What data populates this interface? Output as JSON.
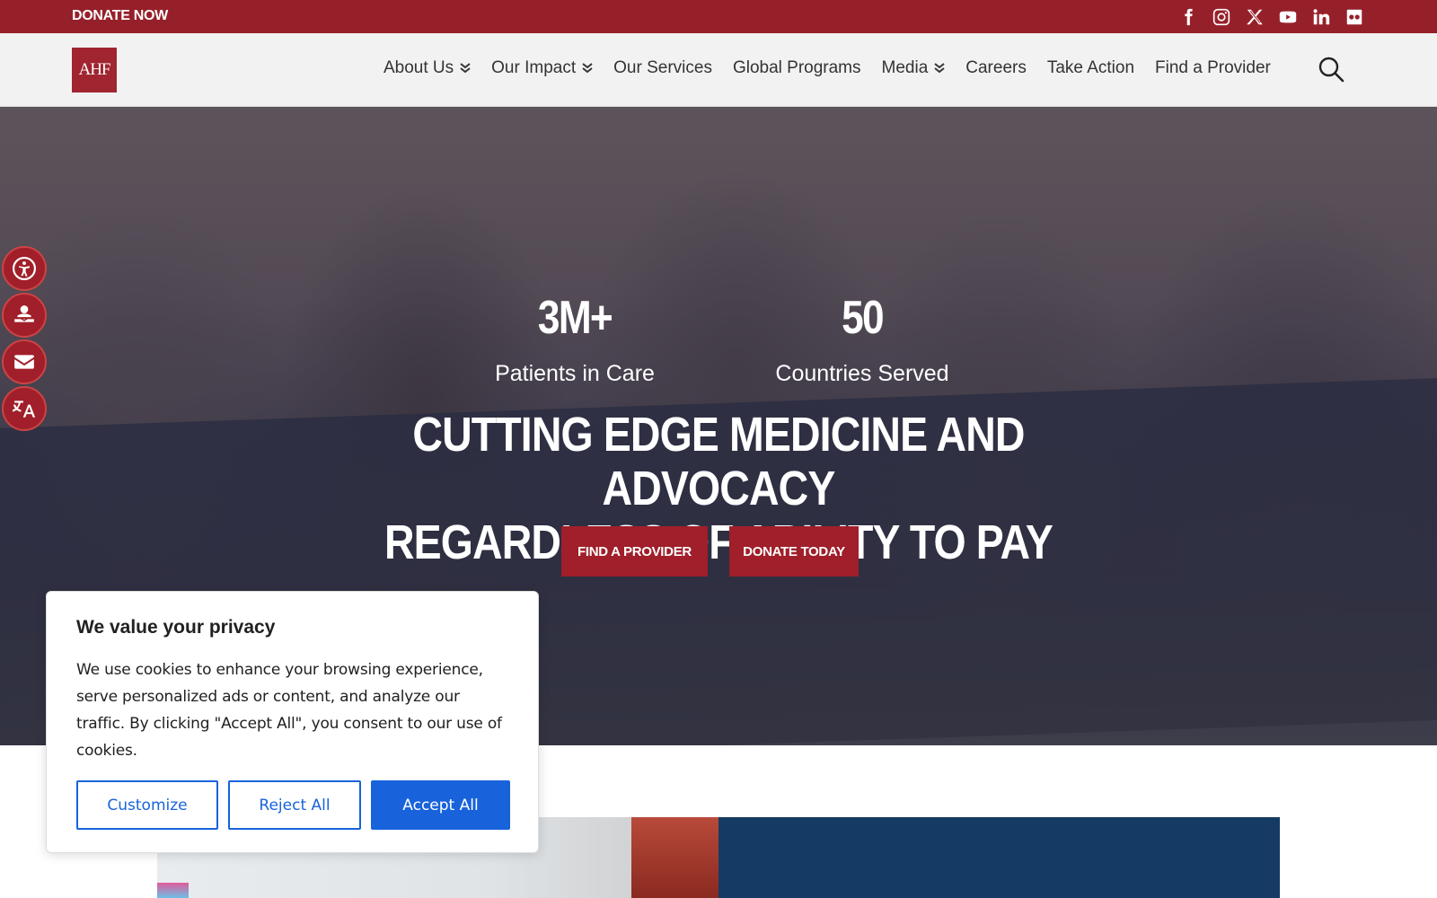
{
  "topbar": {
    "donate_label": "DONATE NOW",
    "socials": [
      "facebook-icon",
      "instagram-icon",
      "x-icon",
      "youtube-icon",
      "linkedin-icon",
      "flickr-icon"
    ]
  },
  "nav": {
    "logo_text": "AHF",
    "items": [
      {
        "label": "About Us",
        "dropdown": true
      },
      {
        "label": "Our Impact",
        "dropdown": true
      },
      {
        "label": "Our Services",
        "dropdown": false
      },
      {
        "label": "Global Programs",
        "dropdown": false
      },
      {
        "label": "Media",
        "dropdown": true
      },
      {
        "label": "Careers",
        "dropdown": false
      },
      {
        "label": "Take Action",
        "dropdown": false
      },
      {
        "label": "Find a Provider",
        "dropdown": false
      }
    ]
  },
  "hero": {
    "stats": [
      {
        "value": "3M+",
        "label": "Patients in Care"
      },
      {
        "value": "50",
        "label": "Countries Served"
      }
    ],
    "headline_line1": "CUTTING EDGE MEDICINE AND ADVOCACY",
    "headline_line2": "REGARDLESS OF ABILITY TO PAY",
    "btn_provider": "FIND A PROVIDER",
    "btn_donate": "DONATE TODAY"
  },
  "side_tools": [
    "accessibility-icon",
    "care-icon",
    "email-icon",
    "translate-icon"
  ],
  "cookie": {
    "title": "We value your privacy",
    "body": "We use cookies to enhance your browsing experience, serve personalized ads or content, and analyze our traffic. By clicking \"Accept All\", you consent to our use of cookies.",
    "customize": "Customize",
    "reject": "Reject All",
    "accept": "Accept All"
  },
  "colors": {
    "brand_red": "#96202a",
    "button_blue": "#1863dc",
    "navy": "#153a63"
  }
}
